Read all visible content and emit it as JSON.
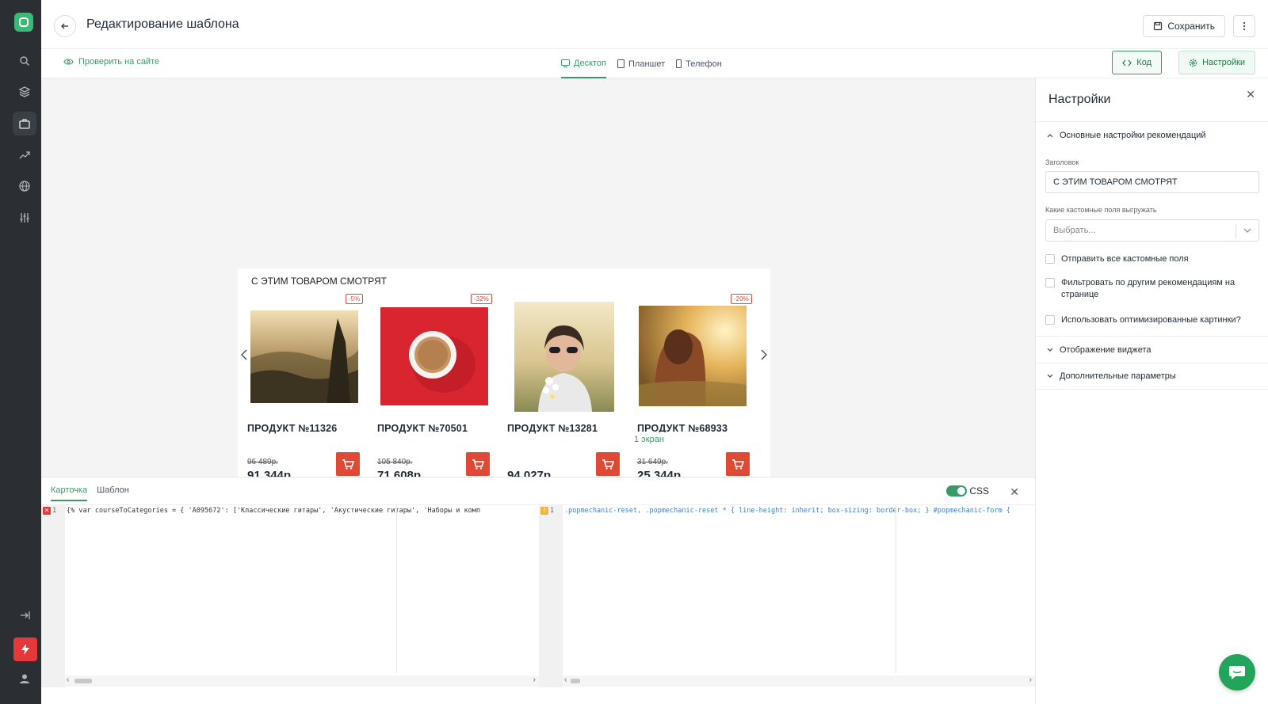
{
  "app": {
    "title": "Редактирование шаблона",
    "save_label": "Сохранить"
  },
  "subheader": {
    "check_site": "Проверить на сайте",
    "devices": [
      {
        "label": "Десктоп",
        "active": true
      },
      {
        "label": "Планшет",
        "active": false
      },
      {
        "label": "Телефон",
        "active": false
      }
    ],
    "code_label": "Код",
    "settings_label": "Настройки"
  },
  "widget": {
    "title": "С ЭТИМ ТОВАРОМ СМОТРЯТ",
    "screen_label": "1 экран",
    "products": [
      {
        "name": "ПРОДУКТ №11326",
        "badge": "-5%",
        "old_price": "96 489р.",
        "new_price": "91 344р."
      },
      {
        "name": "ПРОДУКТ №70501",
        "badge": "-32%",
        "old_price": "105 840р.",
        "new_price": "71 608р."
      },
      {
        "name": "ПРОДУКТ №13281",
        "badge": "",
        "old_price": "",
        "new_price": "94 027р."
      },
      {
        "name": "ПРОДУКТ №68933",
        "badge": "-20%",
        "old_price": "31 649р.",
        "new_price": "25 344р."
      }
    ]
  },
  "codepanel": {
    "tabs": [
      {
        "label": "Карточка",
        "active": true
      },
      {
        "label": "Шаблон",
        "active": false
      }
    ],
    "css_label": "CSS",
    "js_line_no": "1",
    "js_code": "{%      var courseToCategories = {              'A095672': ['Классические гитары', 'Акустические гитары', 'Наборы и комп",
    "css_line_no": "1",
    "css_code": ".popmechanic-reset, .popmechanic-reset * {   line-height: inherit;   box-sizing: border-box; }  #popmechanic-form {"
  },
  "settings": {
    "title": "Настройки",
    "section_main": "Основные настройки рекомендаций",
    "heading_label": "Заголовок",
    "heading_value": "С ЭТИМ ТОВАРОМ СМОТРЯТ",
    "custom_fields_label": "Какие кастомные поля выгружать",
    "custom_fields_placeholder": "Выбрать...",
    "checkboxes": [
      "Отправить все кастомные поля",
      "Фильтровать по другим рекомендациям на странице",
      "Использовать оптимизированные картинки?"
    ],
    "section_display": "Отображение виджета",
    "section_extra": "Дополнительные параметры"
  },
  "colors": {
    "accent": "#3a9a67",
    "rail": "#2b2f34",
    "cart": "#e04a35",
    "danger": "#e5383b"
  }
}
